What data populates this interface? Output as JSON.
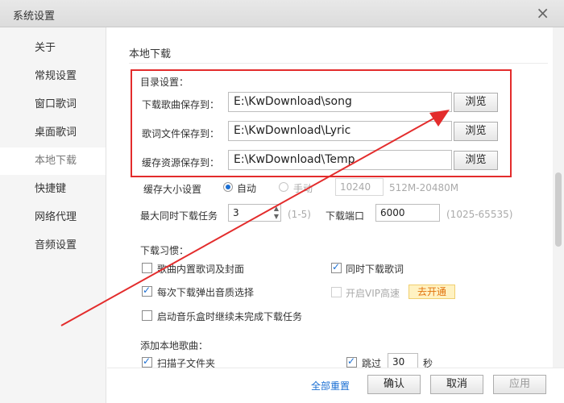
{
  "window": {
    "title": "系统设置",
    "close_glyph": "×"
  },
  "sidebar": {
    "items": [
      {
        "label": "关于"
      },
      {
        "label": "常规设置"
      },
      {
        "label": "窗口歌词"
      },
      {
        "label": "桌面歌词"
      },
      {
        "label": "本地下载",
        "active": true
      },
      {
        "label": "快捷键"
      },
      {
        "label": "网络代理"
      },
      {
        "label": "音频设置"
      }
    ]
  },
  "download": {
    "section_title": "本地下载",
    "dir_group_label": "目录设置：",
    "dirs": [
      {
        "label": "下载歌曲保存到：",
        "value": "E:\\KwDownload\\song",
        "browse": "浏览"
      },
      {
        "label": "歌词文件保存到：",
        "value": "E:\\KwDownload\\Lyric",
        "browse": "浏览"
      },
      {
        "label": "缓存资源保存到：",
        "value": "E:\\KwDownload\\Temp",
        "browse": "浏览"
      }
    ],
    "cache": {
      "label": "缓存大小设置",
      "auto_label": "自动",
      "manual_label": "手动",
      "size_value": "10240",
      "range_hint": "512M-20480M"
    },
    "tasks": {
      "label": "最大同时下载任务",
      "value": "3",
      "range_hint": "(1-5)",
      "port_label": "下载端口",
      "port_value": "6000",
      "port_range": "(1025-65535)"
    },
    "habits": {
      "label": "下载习惯：",
      "embed_lyrics": "歌曲内置歌词及封面",
      "sync_lyrics": "同时下载歌词",
      "quality_popup": "每次下载弹出音质选择",
      "vip_fast": "开启VIP高速",
      "vip_badge": "去开通",
      "resume_tasks": "启动音乐盒时继续未完成下载任务"
    },
    "add_local": {
      "label": "添加本地歌曲：",
      "scan_subfolders": "扫描子文件夹",
      "skip_label": "跳过",
      "skip_seconds": "30",
      "seconds_unit": "秒"
    }
  },
  "footer": {
    "reset": "全部重置",
    "confirm": "确认",
    "cancel": "取消",
    "apply": "应用"
  },
  "colors": {
    "highlight_box": "#e32c2c",
    "arrow": "#e32c2c",
    "accent": "#1b6fd3"
  }
}
